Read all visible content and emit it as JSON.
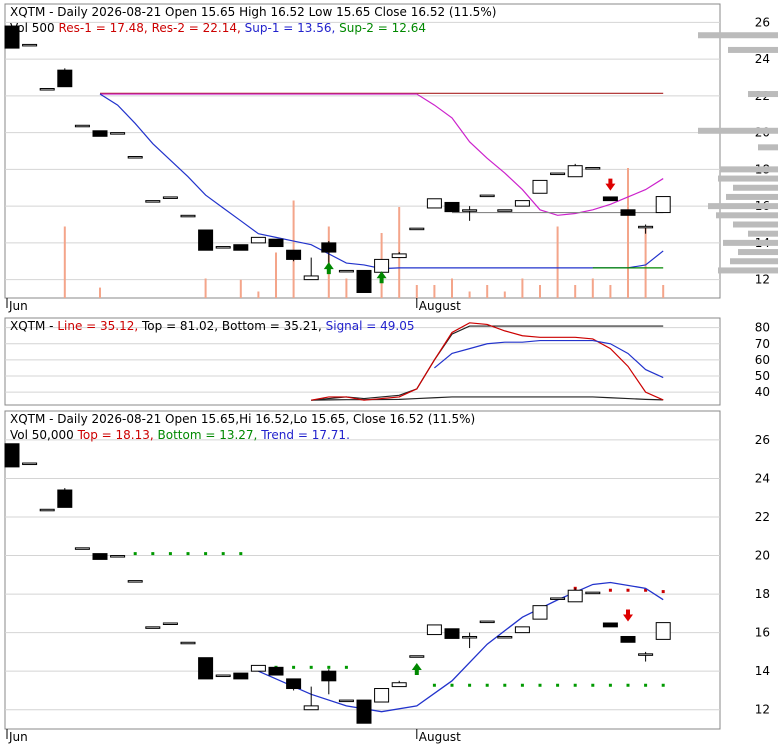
{
  "chart_data": [
    {
      "type": "candlestick",
      "header": {
        "line1": [
          {
            "text": "XQTM - Daily 2026-08-21 Open 15.65  High 16.52  Low 15.65  Close 16.52 (11.5%)",
            "color": "#000000"
          }
        ],
        "line2": [
          {
            "text": "Vol 500",
            "color": "#000000"
          },
          {
            "text": "Res-1 = 17.48,",
            "color": "#cc0000"
          },
          {
            "text": "Res-2 = 22.14,",
            "color": "#cc0000"
          },
          {
            "text": "Sup-1 = 13.56,",
            "color": "#2222cc"
          },
          {
            "text": "Sup-2 = 12.64",
            "color": "#008800"
          }
        ]
      },
      "y_ticks": [
        12,
        14,
        16,
        18,
        20,
        22,
        24,
        26
      ],
      "ylim": [
        11,
        27
      ],
      "x_labels": [
        {
          "i": 0,
          "text": "Jun"
        },
        {
          "i": 23,
          "text": "August"
        }
      ],
      "candles": [
        {
          "o": 25.8,
          "c": 24.6,
          "h": 25.8,
          "l": 24.6
        },
        {
          "o": 24.8,
          "c": 24.8,
          "h": 24.8,
          "l": 24.8
        },
        {
          "o": 22.4,
          "c": 22.4,
          "h": 22.4,
          "l": 22.4
        },
        {
          "o": 23.4,
          "c": 22.5,
          "h": 23.5,
          "l": 22.5
        },
        {
          "o": 20.4,
          "c": 20.4,
          "h": 20.4,
          "l": 20.4
        },
        {
          "o": 20.1,
          "c": 19.8,
          "h": 20.1,
          "l": 19.8
        },
        {
          "o": 20.0,
          "c": 20.0,
          "h": 20.0,
          "l": 20.0
        },
        {
          "o": 18.7,
          "c": 18.7,
          "h": 18.7,
          "l": 18.7
        },
        {
          "o": 16.3,
          "c": 16.3,
          "h": 16.3,
          "l": 16.3
        },
        {
          "o": 16.5,
          "c": 16.5,
          "h": 16.5,
          "l": 16.5
        },
        {
          "o": 15.5,
          "c": 15.5,
          "h": 15.5,
          "l": 15.5
        },
        {
          "o": 14.7,
          "c": 13.6,
          "h": 14.7,
          "l": 13.6
        },
        {
          "o": 13.8,
          "c": 13.8,
          "h": 13.8,
          "l": 13.8
        },
        {
          "o": 13.9,
          "c": 13.6,
          "h": 13.9,
          "l": 13.6
        },
        {
          "o": 14.0,
          "c": 14.3,
          "h": 14.3,
          "l": 14.0
        },
        {
          "o": 14.2,
          "c": 13.8,
          "h": 14.2,
          "l": 13.8
        },
        {
          "o": 13.6,
          "c": 13.1,
          "h": 13.6,
          "l": 13.0
        },
        {
          "o": 12.0,
          "c": 12.2,
          "h": 13.2,
          "l": 12.0
        },
        {
          "o": 14.0,
          "c": 13.5,
          "h": 14.1,
          "l": 12.8
        },
        {
          "o": 12.5,
          "c": 12.5,
          "h": 12.5,
          "l": 12.5
        },
        {
          "o": 12.5,
          "c": 11.3,
          "h": 12.5,
          "l": 11.3
        },
        {
          "o": 12.4,
          "c": 13.1,
          "h": 13.1,
          "l": 12.4
        },
        {
          "o": 13.2,
          "c": 13.4,
          "h": 13.5,
          "l": 13.2
        },
        {
          "o": 14.8,
          "c": 14.8,
          "h": 14.8,
          "l": 14.8
        },
        {
          "o": 15.9,
          "c": 16.4,
          "h": 16.4,
          "l": 15.9
        },
        {
          "o": 16.2,
          "c": 15.7,
          "h": 16.2,
          "l": 15.7
        },
        {
          "o": 15.8,
          "c": 15.8,
          "h": 16.0,
          "l": 15.2
        },
        {
          "o": 16.6,
          "c": 16.6,
          "h": 16.6,
          "l": 16.6
        },
        {
          "o": 15.8,
          "c": 15.8,
          "h": 15.8,
          "l": 15.8
        },
        {
          "o": 16.0,
          "c": 16.3,
          "h": 16.3,
          "l": 16.0
        },
        {
          "o": 16.7,
          "c": 17.4,
          "h": 17.4,
          "l": 16.7
        },
        {
          "o": 17.8,
          "c": 17.8,
          "h": 17.8,
          "l": 17.8
        },
        {
          "o": 17.6,
          "c": 18.2,
          "h": 18.3,
          "l": 17.6
        },
        {
          "o": 18.1,
          "c": 18.1,
          "h": 18.1,
          "l": 18.1
        },
        {
          "o": 16.5,
          "c": 16.3,
          "h": 16.5,
          "l": 16.3
        },
        {
          "o": 15.8,
          "c": 15.5,
          "h": 15.8,
          "l": 15.5
        },
        {
          "o": 14.9,
          "c": 14.9,
          "h": 15.0,
          "l": 14.5
        },
        {
          "o": 15.65,
          "c": 16.52,
          "h": 16.52,
          "l": 15.65
        }
      ],
      "volume": [
        0,
        0,
        0,
        0.55,
        0,
        0.08,
        0,
        0,
        0,
        0,
        0,
        0.15,
        0,
        0.14,
        0.05,
        0.35,
        0.75,
        0,
        0.55,
        0.15,
        0,
        0.5,
        0.7,
        0.1,
        0.1,
        0.15,
        0.05,
        0.1,
        0.05,
        0.15,
        0.1,
        0.55,
        0.1,
        0.15,
        0.1,
        1.0,
        0.55,
        0.1
      ],
      "volume_profile": [
        {
          "price": 12.5,
          "w": 60
        },
        {
          "price": 13.0,
          "w": 48
        },
        {
          "price": 13.5,
          "w": 40
        },
        {
          "price": 14.0,
          "w": 55
        },
        {
          "price": 14.5,
          "w": 30
        },
        {
          "price": 15.0,
          "w": 45
        },
        {
          "price": 15.5,
          "w": 62
        },
        {
          "price": 16.0,
          "w": 70
        },
        {
          "price": 16.5,
          "w": 52
        },
        {
          "price": 17.0,
          "w": 45
        },
        {
          "price": 17.5,
          "w": 60
        },
        {
          "price": 18.0,
          "w": 58
        },
        {
          "price": 19.2,
          "w": 20
        },
        {
          "price": 20.1,
          "w": 80
        },
        {
          "price": 22.1,
          "w": 30
        },
        {
          "price": 24.5,
          "w": 50
        },
        {
          "price": 25.3,
          "w": 80
        }
      ],
      "res2": {
        "from": 5,
        "to": 37,
        "value": 22.14
      },
      "res1": {
        "from": 5,
        "to": 37,
        "values": [
          22.1,
          22.1,
          22.1,
          22.1,
          22.1,
          22.1,
          22.1,
          22.1,
          22.1,
          22.1,
          22.1,
          22.1,
          22.1,
          22.1,
          22.1,
          22.1,
          22.1,
          22.1,
          22.1,
          21.5,
          20.8,
          19.5,
          18.6,
          17.8,
          16.9,
          15.8,
          15.5,
          15.6,
          15.8,
          16.1,
          16.5,
          16.9,
          17.5
        ]
      },
      "sup1": {
        "from": 5,
        "to": 37,
        "values": [
          22.1,
          21.5,
          20.5,
          19.4,
          18.5,
          17.6,
          16.6,
          15.9,
          15.2,
          14.5,
          14.3,
          14.1,
          13.9,
          13.4,
          12.9,
          12.8,
          12.6,
          12.64,
          12.64,
          12.64,
          12.64,
          12.64,
          12.64,
          12.64,
          12.64,
          12.64,
          12.64,
          12.64,
          12.64,
          12.64,
          12.64,
          12.8,
          13.56
        ]
      },
      "sup2": {
        "from": 33,
        "to": 37,
        "value": 12.64
      },
      "extension_line": {
        "from": 25,
        "to": 37,
        "value": 15.65
      },
      "arrows": [
        {
          "i": 18,
          "price": 12.3,
          "dir": "up",
          "color": "#008800"
        },
        {
          "i": 21,
          "price": 11.8,
          "dir": "up",
          "color": "#008800"
        },
        {
          "i": 34,
          "price": 17.5,
          "dir": "down",
          "color": "#dd0000"
        }
      ]
    },
    {
      "type": "line",
      "header": [
        {
          "text": "XQTM -",
          "color": "#000000"
        },
        {
          "text": "Line = 35.12,",
          "color": "#cc0000"
        },
        {
          "text": "Top = 81.02,",
          "color": "#000000"
        },
        {
          "text": "Bottom = 35.21,",
          "color": "#000000"
        },
        {
          "text": "Signal = 49.05",
          "color": "#2222cc"
        }
      ],
      "y_ticks": [
        40,
        50,
        60,
        70,
        80
      ],
      "ylim": [
        32,
        86
      ],
      "top": {
        "from": 17,
        "to": 37,
        "values": [
          35,
          36,
          37,
          36,
          37,
          38,
          42,
          60,
          76,
          81,
          81,
          81,
          81,
          81,
          81,
          81,
          81,
          81,
          81,
          81,
          81
        ]
      },
      "bottom": {
        "from": 17,
        "to": 37,
        "values": [
          35,
          35.2,
          35.3,
          35.3,
          35.4,
          35.5,
          36,
          36.5,
          37,
          37,
          37,
          37,
          37,
          37,
          37,
          37,
          37,
          36.5,
          36,
          35.5,
          35.2
        ]
      },
      "line": {
        "from": 17,
        "to": 37,
        "values": [
          35,
          37,
          37,
          35,
          36,
          37,
          42,
          60,
          77,
          83,
          82,
          78,
          75,
          74,
          74,
          74,
          73,
          67,
          56,
          40,
          35.12
        ]
      },
      "signal": {
        "from": 24,
        "to": 37,
        "values": [
          55,
          64,
          67,
          70,
          71,
          71,
          72,
          72,
          72,
          72,
          70,
          64,
          54,
          49.05
        ]
      }
    },
    {
      "type": "candlestick",
      "header": {
        "line1": [
          {
            "text": "XQTM - Daily 2026-08-21 Open 15.65,Hi 16.52,Lo 15.65,  Close 16.52 (11.5%)",
            "color": "#000000"
          }
        ],
        "line2": [
          {
            "text": "Vol 50,000",
            "color": "#000000"
          },
          {
            "text": "Top = 18.13,",
            "color": "#cc0000"
          },
          {
            "text": "Bottom = 13.27,",
            "color": "#008800"
          },
          {
            "text": "Trend = 17.71.",
            "color": "#2222cc"
          }
        ]
      },
      "y_ticks": [
        12,
        14,
        16,
        18,
        20,
        22,
        24,
        26
      ],
      "ylim": [
        11,
        27.5
      ],
      "x_labels": [
        {
          "i": 0,
          "text": "Jun"
        },
        {
          "i": 23,
          "text": "August"
        }
      ],
      "top_dots": [
        {
          "i": 32,
          "price": 18.3
        },
        {
          "i": 34,
          "price": 18.2
        },
        {
          "i": 35,
          "price": 18.2
        },
        {
          "i": 36,
          "price": 18.2
        },
        {
          "i": 37,
          "price": 18.13
        }
      ],
      "bottom_dots_high": {
        "from": 7,
        "to": 13,
        "value": 20.1
      },
      "bottom_dots_mid": {
        "from": 15,
        "to": 19,
        "value": 14.2
      },
      "bottom_dots_low": {
        "from": 24,
        "to": 37,
        "value": 13.27
      },
      "trend": [
        {
          "i": 14,
          "price": 14.0
        },
        {
          "i": 17,
          "price": 12.8
        },
        {
          "i": 19,
          "price": 12.2
        },
        {
          "i": 21,
          "price": 11.9
        },
        {
          "i": 23,
          "price": 12.2
        },
        {
          "i": 25,
          "price": 13.5
        },
        {
          "i": 27,
          "price": 15.4
        },
        {
          "i": 29,
          "price": 16.8
        },
        {
          "i": 31,
          "price": 17.7
        },
        {
          "i": 33,
          "price": 18.5
        },
        {
          "i": 34,
          "price": 18.6
        },
        {
          "i": 36,
          "price": 18.3
        },
        {
          "i": 37,
          "price": 17.71
        }
      ],
      "arrows": [
        {
          "i": 23,
          "price": 13.8,
          "dir": "up",
          "color": "#008800"
        },
        {
          "i": 35,
          "price": 17.2,
          "dir": "down",
          "color": "#dd0000"
        }
      ]
    }
  ]
}
